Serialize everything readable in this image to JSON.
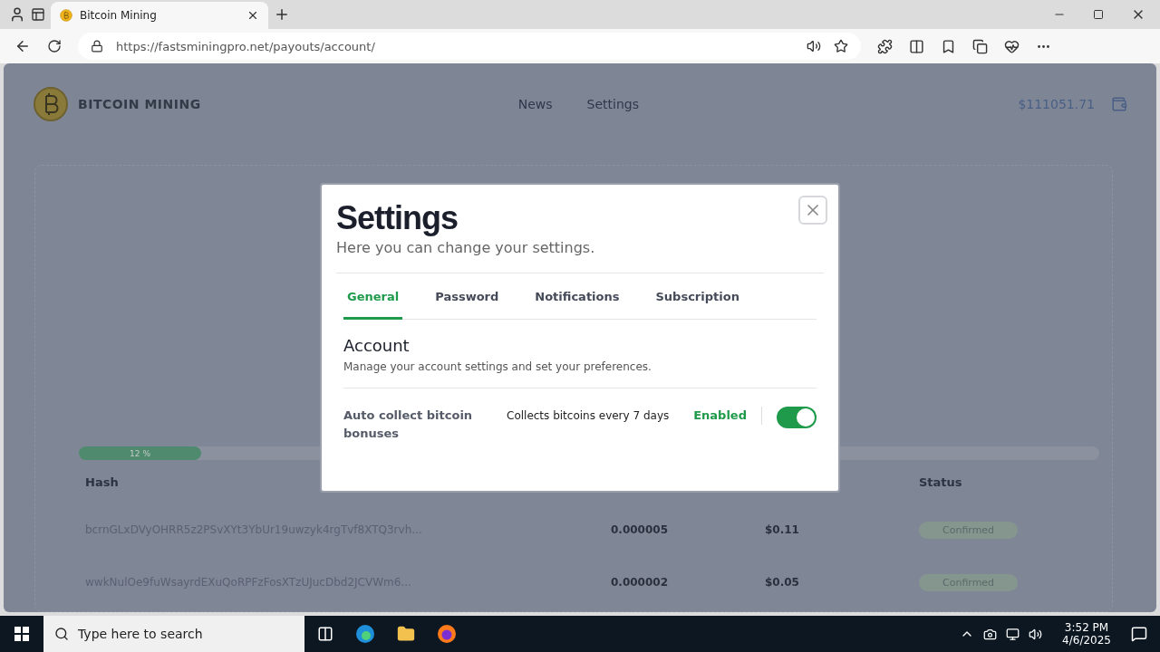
{
  "browser": {
    "tab_title": "Bitcoin Mining",
    "url": "https://fastsminingpro.net/payouts/account/"
  },
  "site": {
    "brand": "BITCOIN MINING",
    "nav": [
      {
        "label": "News"
      },
      {
        "label": "Settings"
      }
    ],
    "balance": "$111051.71"
  },
  "progress": {
    "level": 0.12,
    "label": "12 %"
  },
  "table": {
    "columns": [
      {
        "label": "Hash",
        "kind": "hash"
      },
      {
        "kind": "amount"
      },
      {
        "kind": "usd"
      },
      {
        "label": "Status",
        "kind": "status"
      }
    ],
    "rows": [
      {
        "hash": "bcrnGLxDVyOHRR5z2PSvXYt3YbUr19uwzyk4rgTvf8XTQ3rvh...",
        "amount": "0.000005",
        "usd": "$0.11",
        "status": "Confirmed"
      },
      {
        "hash": "wwkNulOe9fuWsayrdEXuQoRPFzFosXTzUJucDbd2JCVWm6...",
        "amount": "0.000002",
        "usd": "$0.05",
        "status": "Confirmed"
      }
    ]
  },
  "modal": {
    "title": "Settings",
    "subtitle": "Here you can change your settings.",
    "tabs": [
      {
        "label": "General",
        "selected": true
      },
      {
        "label": "Password",
        "selected": false
      },
      {
        "label": "Notifications",
        "selected": false
      },
      {
        "label": "Subscription",
        "selected": false
      }
    ],
    "section_title": "Account",
    "section_description": "Manage your account settings and set your preferences.",
    "setting": {
      "label": "Auto collect bitcoin bonuses",
      "description": "Collects bitcoins every 7 days",
      "status": "Enabled",
      "on": true
    }
  },
  "taskbar": {
    "search_placeholder": "Type here to search",
    "time": "3:52 PM",
    "date": "4/6/2025"
  }
}
